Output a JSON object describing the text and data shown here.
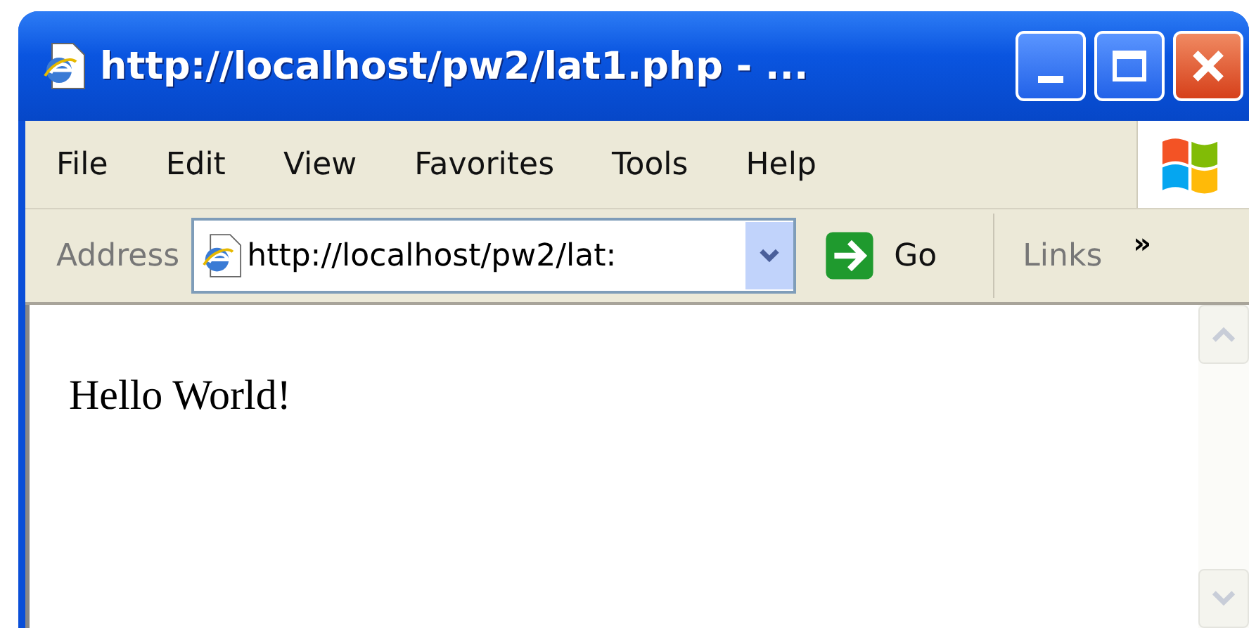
{
  "window": {
    "title": "http://localhost/pw2/lat1.php - ..."
  },
  "menu": [
    {
      "label": "File"
    },
    {
      "label": "Edit"
    },
    {
      "label": "View"
    },
    {
      "label": "Favorites"
    },
    {
      "label": "Tools"
    },
    {
      "label": "Help"
    }
  ],
  "address_bar": {
    "label": "Address",
    "value": "http://localhost/pw2/lat:",
    "go": "Go",
    "links": "Links",
    "more": "»"
  },
  "content": {
    "text": "Hello World!"
  }
}
